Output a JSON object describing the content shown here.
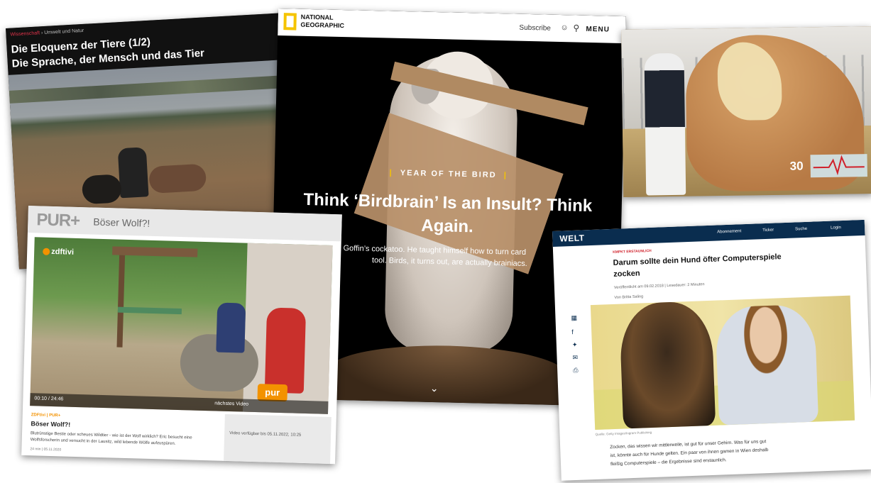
{
  "arte": {
    "breadcrumb_section": "Wissenschaft",
    "breadcrumb_sub": "Umwelt und Natur",
    "title_line1": "Die Eloquenz der Tiere (1/2)",
    "title_line2": "Die Sprache, der Mensch und das Tier"
  },
  "natgeo": {
    "logo_line1": "NATIONAL",
    "logo_line2": "GEOGRAPHIC",
    "subscribe": "Subscribe",
    "user_icon": "user-icon",
    "search_icon": "search-icon",
    "menu": "MENU",
    "kicker": "YEAR OF THE BIRD",
    "headline_line1": "Think ‘Birdbrain’ Is an Insult? Think",
    "headline_line2": "Again.",
    "deck_line1": "a Goffin’s cockatoo. He taught himself how to turn card",
    "deck_line2": "tool. Birds, it turns out, are actually brainiacs."
  },
  "horse": {
    "heart_rate": "30"
  },
  "pur": {
    "logo": "PUR+",
    "title": "Böser Wolf?!",
    "channel": "zdftivi",
    "badge": "pur",
    "timecode": "00:10 / 24:46",
    "next_video": "nächstes Video",
    "kicker": "ZDFtivi | PUR+",
    "headline": "Böser Wolf?!",
    "body_line1": "Blutrünstige Bestie oder scheues Wildtier - wie ist der Wolf wirklich? Eric besucht eine",
    "body_line2": "Wolfsforscherin und versucht in der Lausitz, wild lebende Wölfe aufzuspüren.",
    "meta": "24 min | 05.11.2020",
    "available": "Video verfügbar bis 05.11.2022, 10:25"
  },
  "welt": {
    "logo": "WELT",
    "nav_abo": "Abonnement",
    "nav_ticker": "Ticker",
    "nav_search": "Suche",
    "nav_login": "Login",
    "kicker": "KMPKT   ERSTAUNLICH",
    "headline_line1": "Darum sollte dein Hund öfter Computerspiele",
    "headline_line2": "zocken",
    "published": "Veröffentlicht am 09.02.2018 | Lesedauer: 2 Minuten",
    "author": "Von Britta Saling",
    "caption": "Quelle: Getty Images/Ingram Publishing",
    "para_line1": "Zocken, das wissen wir mittlerweile, ist gut für unser Gehirn. Was für uns gut",
    "para_line2": "ist, könnte auch für Hunde gelten. Ein paar von ihnen gamen in Wien deshalb",
    "para_line3": "fleißig Computerspiele – die Ergebnisse sind erstaunlich."
  }
}
